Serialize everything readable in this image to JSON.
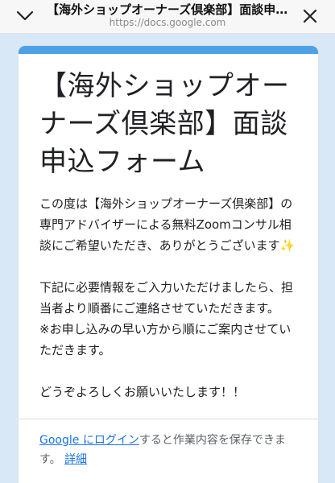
{
  "browser": {
    "title": "【海外ショップオーナーズ倶楽部】面談申込フォーム",
    "url": "https://docs.google.com",
    "back_icon": "chevron-down-icon",
    "close_icon": "close-icon"
  },
  "form": {
    "title": "【海外ショップオーナーズ倶楽部】面談申込フォーム",
    "description": {
      "intro": "この度は【海外ショップオーナーズ倶楽部】の専門アドバイザーによる無料Zoomコンサル相談にご希望いただき、ありがとうございます✨",
      "notice": "下記に必要情報をご入力いただけましたら、担当者より順番にご連絡させていただきます。\n※お申し込みの早い方から順にご案内させていただきます。",
      "closing": "どうぞよろしくお願いいたします！！"
    }
  },
  "signin": {
    "login_link": "Google にログイン",
    "message": "すると作業内容を保存できます。",
    "details_link": "詳細"
  },
  "colors": {
    "page_bg": "#d9e8f7",
    "accent": "#4ea1e6",
    "link": "#1a73e8"
  }
}
